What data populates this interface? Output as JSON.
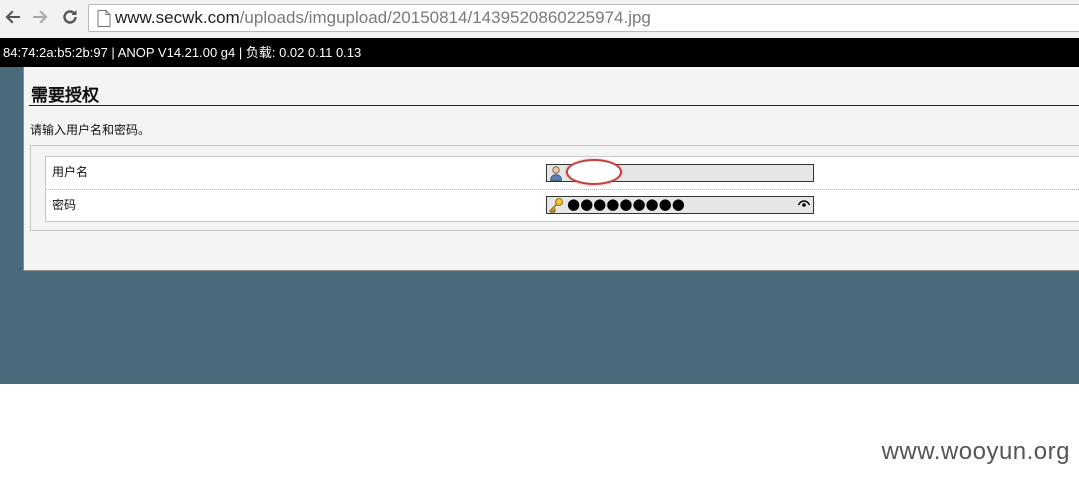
{
  "browser": {
    "url_host": "www.secwk.com",
    "url_path": "/uploads/imgupload/20150814/1439520860225974.jpg",
    "icons": {
      "back": "arrow-left",
      "forward": "arrow-right",
      "reload": "reload",
      "page": "document"
    }
  },
  "status_line": "84:74:2a:b5:2b:97 | ANOP V14.21.00 g4 | 负载: 0.02 0.11 0.13",
  "auth": {
    "title": "需要授权",
    "prompt": "请输入用户名和密码。",
    "username_label": "用户名",
    "password_label": "密码",
    "password_mask": "●●●●●●●●●",
    "icons": {
      "username": "user-icon",
      "password": "key-icon",
      "reveal": "eye-icon"
    }
  },
  "colors": {
    "page_background": "#4b6a7c",
    "panel": "#f4f4f4",
    "highlight": "#c84040"
  },
  "watermark": "www.wooyun.org"
}
